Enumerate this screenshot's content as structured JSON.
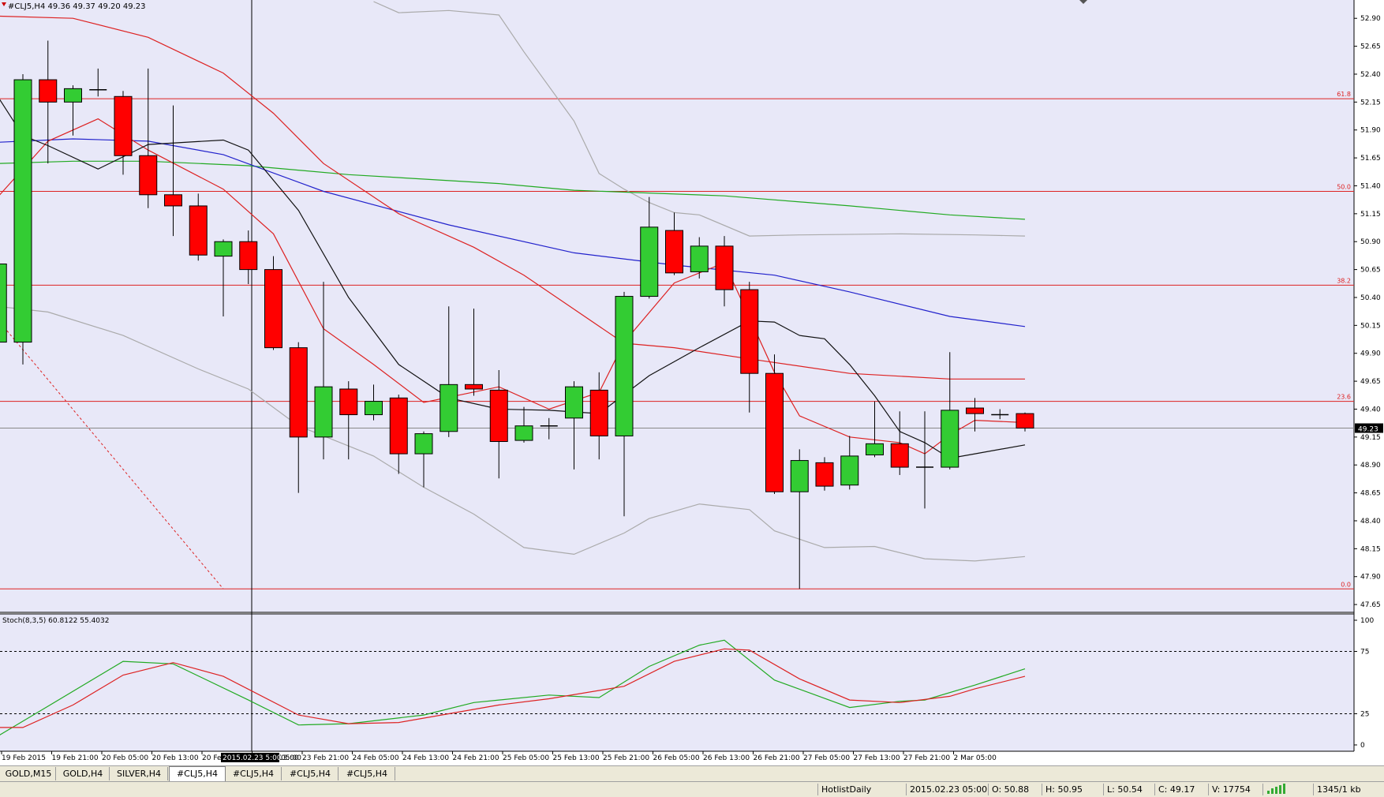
{
  "chart_data": {
    "type": "candlestick",
    "header": "#CLJ5,H4  49.36 49.37 49.20 49.23",
    "colors": {
      "bg": "#e8e8f8",
      "bull": "#33cc33",
      "bear": "#ff0000",
      "fib": "#dd2222",
      "ma_blue": "#2222cc",
      "ma_green": "#22aa22",
      "ma_red": "#dd2222",
      "ma_black": "#111111",
      "band": "#aaaaaa",
      "stoch_main": "#22aa22",
      "stoch_signal": "#dd2222"
    },
    "price_axis": {
      "min": 47.58,
      "max": 53.05,
      "ticks": [
        "52.90",
        "52.65",
        "52.40",
        "52.15",
        "51.90",
        "51.65",
        "51.40",
        "51.15",
        "50.90",
        "50.65",
        "50.40",
        "50.15",
        "49.90",
        "49.65",
        "49.40",
        "49.15",
        "48.90",
        "48.65",
        "48.40",
        "48.15",
        "47.90",
        "47.65"
      ]
    },
    "current_price": "49.23",
    "current_price_value": 49.23,
    "fib_levels": [
      {
        "label": "61.8",
        "price": 52.18
      },
      {
        "label": "50.0",
        "price": 51.35
      },
      {
        "label": "38.2",
        "price": 50.51
      },
      {
        "label": "23.6",
        "price": 49.47
      },
      {
        "label": "0.0",
        "price": 47.79
      }
    ],
    "candles": [
      {
        "i": -1,
        "o": 50.0,
        "h": 51.6,
        "l": 49.8,
        "c": 50.7
      },
      {
        "i": 0,
        "o": 50.0,
        "h": 52.4,
        "l": 49.8,
        "c": 52.35
      },
      {
        "i": 1,
        "o": 52.35,
        "h": 52.7,
        "l": 51.6,
        "c": 52.15
      },
      {
        "i": 2,
        "o": 52.15,
        "h": 52.3,
        "l": 51.85,
        "c": 52.27
      },
      {
        "i": 3,
        "o": 52.26,
        "h": 52.45,
        "l": 52.2,
        "c": 52.26
      },
      {
        "i": 4,
        "o": 52.2,
        "h": 52.25,
        "l": 51.5,
        "c": 51.67
      },
      {
        "i": 5,
        "o": 51.67,
        "h": 52.45,
        "l": 51.2,
        "c": 51.32
      },
      {
        "i": 6,
        "o": 51.32,
        "h": 52.12,
        "l": 50.95,
        "c": 51.22
      },
      {
        "i": 7,
        "o": 51.22,
        "h": 51.33,
        "l": 50.73,
        "c": 50.78
      },
      {
        "i": 8,
        "o": 50.77,
        "h": 50.92,
        "l": 50.23,
        "c": 50.9
      },
      {
        "i": 9,
        "o": 50.9,
        "h": 51.0,
        "l": 50.52,
        "c": 50.65
      },
      {
        "i": 10,
        "o": 50.65,
        "h": 50.77,
        "l": 49.93,
        "c": 49.95
      },
      {
        "i": 11,
        "o": 49.95,
        "h": 50.0,
        "l": 48.65,
        "c": 49.15
      },
      {
        "i": 12,
        "o": 49.15,
        "h": 50.54,
        "l": 48.95,
        "c": 49.6
      },
      {
        "i": 13,
        "o": 49.58,
        "h": 49.65,
        "l": 48.95,
        "c": 49.35
      },
      {
        "i": 14,
        "o": 49.35,
        "h": 49.62,
        "l": 49.3,
        "c": 49.47
      },
      {
        "i": 15,
        "o": 49.5,
        "h": 49.53,
        "l": 48.82,
        "c": 49.0
      },
      {
        "i": 16,
        "o": 49.0,
        "h": 49.2,
        "l": 48.7,
        "c": 49.18
      },
      {
        "i": 17,
        "o": 49.2,
        "h": 50.32,
        "l": 49.15,
        "c": 49.62
      },
      {
        "i": 18,
        "o": 49.62,
        "h": 50.3,
        "l": 49.52,
        "c": 49.58
      },
      {
        "i": 19,
        "o": 49.57,
        "h": 49.75,
        "l": 48.78,
        "c": 49.11
      },
      {
        "i": 20,
        "o": 49.12,
        "h": 49.42,
        "l": 49.1,
        "c": 49.25
      },
      {
        "i": 21,
        "o": 49.25,
        "h": 49.32,
        "l": 49.13,
        "c": 49.24
      },
      {
        "i": 22,
        "o": 49.32,
        "h": 49.65,
        "l": 48.86,
        "c": 49.6
      },
      {
        "i": 23,
        "o": 49.57,
        "h": 49.73,
        "l": 48.95,
        "c": 49.16
      },
      {
        "i": 24,
        "o": 49.16,
        "h": 50.45,
        "l": 48.44,
        "c": 50.41
      },
      {
        "i": 25,
        "o": 50.41,
        "h": 51.3,
        "l": 50.39,
        "c": 51.03
      },
      {
        "i": 26,
        "o": 51.0,
        "h": 51.16,
        "l": 50.6,
        "c": 50.62
      },
      {
        "i": 27,
        "o": 50.63,
        "h": 50.94,
        "l": 50.57,
        "c": 50.86
      },
      {
        "i": 28,
        "o": 50.86,
        "h": 50.95,
        "l": 50.32,
        "c": 50.47
      },
      {
        "i": 29,
        "o": 50.47,
        "h": 50.54,
        "l": 49.37,
        "c": 49.72
      },
      {
        "i": 30,
        "o": 49.72,
        "h": 49.89,
        "l": 48.64,
        "c": 48.66
      },
      {
        "i": 31,
        "o": 48.66,
        "h": 49.04,
        "l": 47.79,
        "c": 48.94
      },
      {
        "i": 32,
        "o": 48.92,
        "h": 48.97,
        "l": 48.67,
        "c": 48.71
      },
      {
        "i": 33,
        "o": 48.72,
        "h": 49.16,
        "l": 48.68,
        "c": 48.98
      },
      {
        "i": 34,
        "o": 48.99,
        "h": 49.47,
        "l": 48.97,
        "c": 49.09
      },
      {
        "i": 35,
        "o": 49.09,
        "h": 49.38,
        "l": 48.81,
        "c": 48.88
      },
      {
        "i": 36,
        "o": 48.88,
        "h": 49.38,
        "l": 48.51,
        "c": 48.87
      },
      {
        "i": 37,
        "o": 48.88,
        "h": 49.91,
        "l": 48.86,
        "c": 49.39
      },
      {
        "i": 38,
        "o": 49.41,
        "h": 49.5,
        "l": 49.2,
        "c": 49.36
      },
      {
        "i": 39,
        "o": 49.35,
        "h": 49.4,
        "l": 49.31,
        "c": 49.35
      },
      {
        "i": 40,
        "o": 49.36,
        "h": 49.37,
        "l": 49.2,
        "c": 49.23
      }
    ],
    "ma_blue": [
      [
        -1,
        51.79
      ],
      [
        2,
        51.82
      ],
      [
        5,
        51.8
      ],
      [
        8,
        51.68
      ],
      [
        12,
        51.35
      ],
      [
        17,
        51.05
      ],
      [
        22,
        50.8
      ],
      [
        26,
        50.69
      ],
      [
        30,
        50.6
      ],
      [
        33,
        50.45
      ],
      [
        37,
        50.23
      ],
      [
        40,
        50.14
      ]
    ],
    "ma_green": [
      [
        -1,
        51.6
      ],
      [
        2,
        51.62
      ],
      [
        5,
        51.62
      ],
      [
        9,
        51.58
      ],
      [
        13,
        51.5
      ],
      [
        19,
        51.42
      ],
      [
        22,
        51.36
      ],
      [
        28,
        51.31
      ],
      [
        33,
        51.22
      ],
      [
        37,
        51.14
      ],
      [
        40,
        51.1
      ]
    ],
    "ma_red_slow": [
      [
        -1,
        52.92
      ],
      [
        2,
        52.9
      ],
      [
        5,
        52.73
      ],
      [
        8,
        52.41
      ],
      [
        10,
        52.05
      ],
      [
        12,
        51.6
      ],
      [
        15,
        51.15
      ],
      [
        18,
        50.85
      ],
      [
        20,
        50.6
      ],
      [
        24,
        49.99
      ],
      [
        26,
        49.95
      ],
      [
        29,
        49.85
      ],
      [
        33,
        49.72
      ],
      [
        37,
        49.67
      ],
      [
        40,
        49.67
      ]
    ],
    "ma_red_fast": [
      [
        -1,
        51.3
      ],
      [
        1,
        51.8
      ],
      [
        3,
        52.0
      ],
      [
        5,
        51.72
      ],
      [
        8,
        51.37
      ],
      [
        10,
        50.97
      ],
      [
        12,
        50.12
      ],
      [
        14,
        49.8
      ],
      [
        16,
        49.46
      ],
      [
        19,
        49.6
      ],
      [
        21,
        49.4
      ],
      [
        23,
        49.55
      ],
      [
        24,
        50.0
      ],
      [
        26,
        50.53
      ],
      [
        28,
        50.71
      ],
      [
        29,
        50.22
      ],
      [
        30,
        49.73
      ],
      [
        31,
        49.34
      ],
      [
        33,
        49.15
      ],
      [
        35,
        49.1
      ],
      [
        36,
        49.0
      ],
      [
        37,
        49.17
      ],
      [
        38,
        49.3
      ],
      [
        40,
        49.28
      ]
    ],
    "ma_black": [
      [
        -1,
        52.2
      ],
      [
        0,
        51.85
      ],
      [
        1,
        51.76
      ],
      [
        3,
        51.55
      ],
      [
        5,
        51.77
      ],
      [
        8,
        51.81
      ],
      [
        9,
        51.72
      ],
      [
        11,
        51.18
      ],
      [
        13,
        50.4
      ],
      [
        15,
        49.8
      ],
      [
        17,
        49.5
      ],
      [
        19,
        49.4
      ],
      [
        21,
        49.39
      ],
      [
        23,
        49.36
      ],
      [
        25,
        49.7
      ],
      [
        27,
        49.95
      ],
      [
        29,
        50.19
      ],
      [
        30,
        50.18
      ],
      [
        31,
        50.06
      ],
      [
        32,
        50.03
      ],
      [
        33,
        49.8
      ],
      [
        34,
        49.52
      ],
      [
        35,
        49.2
      ],
      [
        36,
        49.1
      ],
      [
        37,
        48.96
      ],
      [
        38,
        49.0
      ],
      [
        40,
        49.08
      ]
    ],
    "band_upper": [
      [
        14,
        53.05
      ],
      [
        15,
        52.95
      ],
      [
        17,
        52.97
      ],
      [
        19,
        52.93
      ],
      [
        20,
        52.6
      ],
      [
        22,
        51.98
      ],
      [
        23,
        51.51
      ],
      [
        24,
        51.37
      ],
      [
        25,
        51.25
      ],
      [
        26,
        51.16
      ],
      [
        27,
        51.14
      ],
      [
        29,
        50.95
      ],
      [
        31,
        50.96
      ],
      [
        35,
        50.97
      ],
      [
        38,
        50.96
      ],
      [
        40,
        50.95
      ]
    ],
    "band_lower": [
      [
        -1,
        50.32
      ],
      [
        1,
        50.27
      ],
      [
        4,
        50.06
      ],
      [
        7,
        49.76
      ],
      [
        9,
        49.58
      ],
      [
        11,
        49.25
      ],
      [
        14,
        48.98
      ],
      [
        16,
        48.7
      ],
      [
        18,
        48.46
      ],
      [
        20,
        48.16
      ],
      [
        22,
        48.1
      ],
      [
        24,
        48.29
      ],
      [
        25,
        48.42
      ],
      [
        27,
        48.55
      ],
      [
        29,
        48.5
      ],
      [
        30,
        48.31
      ],
      [
        32,
        48.16
      ],
      [
        34,
        48.17
      ],
      [
        36,
        48.06
      ],
      [
        38,
        48.04
      ],
      [
        40,
        48.08
      ]
    ],
    "fib_diagonal": [
      [
        -1,
        50.2
      ],
      [
        8,
        47.79
      ]
    ],
    "stochastic": {
      "label": "Stoch(8,3,5) 60.8122 55.4032",
      "levels": [
        "100",
        "75",
        "25",
        "0"
      ],
      "main": [
        [
          -1,
          7
        ],
        [
          1,
          31
        ],
        [
          4,
          67
        ],
        [
          6,
          65
        ],
        [
          9,
          36
        ],
        [
          11,
          16
        ],
        [
          13,
          17
        ],
        [
          16,
          24
        ],
        [
          18,
          34
        ],
        [
          21,
          40
        ],
        [
          23,
          38
        ],
        [
          25,
          63
        ],
        [
          27,
          80
        ],
        [
          28,
          84
        ],
        [
          30,
          52
        ],
        [
          33,
          30
        ],
        [
          35,
          35
        ],
        [
          36,
          36
        ],
        [
          38,
          48
        ],
        [
          40,
          61
        ]
      ],
      "signal": [
        [
          -1,
          14
        ],
        [
          0,
          14
        ],
        [
          2,
          32
        ],
        [
          4,
          56
        ],
        [
          6,
          66
        ],
        [
          8,
          55
        ],
        [
          11,
          24
        ],
        [
          13,
          17
        ],
        [
          15,
          18
        ],
        [
          17,
          25
        ],
        [
          19,
          32
        ],
        [
          21,
          37
        ],
        [
          24,
          47
        ],
        [
          26,
          67
        ],
        [
          28,
          77
        ],
        [
          29,
          76
        ],
        [
          31,
          53
        ],
        [
          33,
          36
        ],
        [
          35,
          34
        ],
        [
          37,
          39
        ],
        [
          38,
          45
        ],
        [
          40,
          55
        ]
      ]
    },
    "time_labels": [
      "19 Feb 2015",
      "19 Feb 21:00",
      "20 Feb 05:00",
      "20 Feb 13:00",
      "20 Fe",
      "23 Feb 13:00",
      "23 Feb 21:00",
      "24 Feb 05:00",
      "24 Feb 13:00",
      "24 Feb 21:00",
      "25 Feb 05:00",
      "25 Feb 13:00",
      "25 Feb 21:00",
      "26 Feb 05:00",
      "26 Feb 13:00",
      "26 Feb 21:00",
      "27 Feb 05:00",
      "27 Feb 13:00",
      "27 Feb 21:00",
      "2 Mar 05:00"
    ],
    "crosshair_time": "2015.02.23 5:00",
    "crosshair_tail": "05:00"
  },
  "tabs": [
    "GOLD,M15",
    "GOLD,H4",
    "SILVER,H4",
    "#CLJ5,H4",
    "#CLJ5,H4",
    "#CLJ5,H4",
    "#CLJ5,H4"
  ],
  "active_tab": 3,
  "status": {
    "profile": "HotlistDaily",
    "datetime": "2015.02.23 05:00",
    "open": "O: 50.88",
    "high": "H: 50.95",
    "low": "L: 50.54",
    "close": "C: 49.17",
    "volume": "V: 17754",
    "traffic": "1345/1 kb"
  }
}
